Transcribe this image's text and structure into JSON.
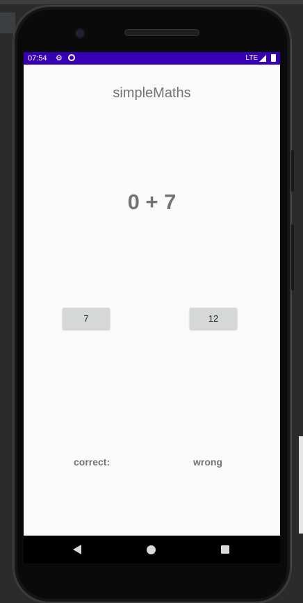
{
  "status_bar": {
    "time": "07:54",
    "network": "LTE",
    "background_color": "#3700b3",
    "icons": [
      "notification-icon",
      "sync-icon",
      "signal-icon",
      "battery-icon"
    ]
  },
  "app": {
    "title": "simpleMaths",
    "question": "0 + 7",
    "answers": [
      "7",
      "12"
    ],
    "correct_label": "correct:",
    "wrong_label": "wrong"
  },
  "navigation": {
    "buttons": [
      "back-icon",
      "home-icon",
      "recents-icon"
    ]
  },
  "colors": {
    "accent": "#3700b3",
    "screen_background": "#fafafa",
    "text_gray": "#737373",
    "button_gray": "#d6d7d7"
  }
}
